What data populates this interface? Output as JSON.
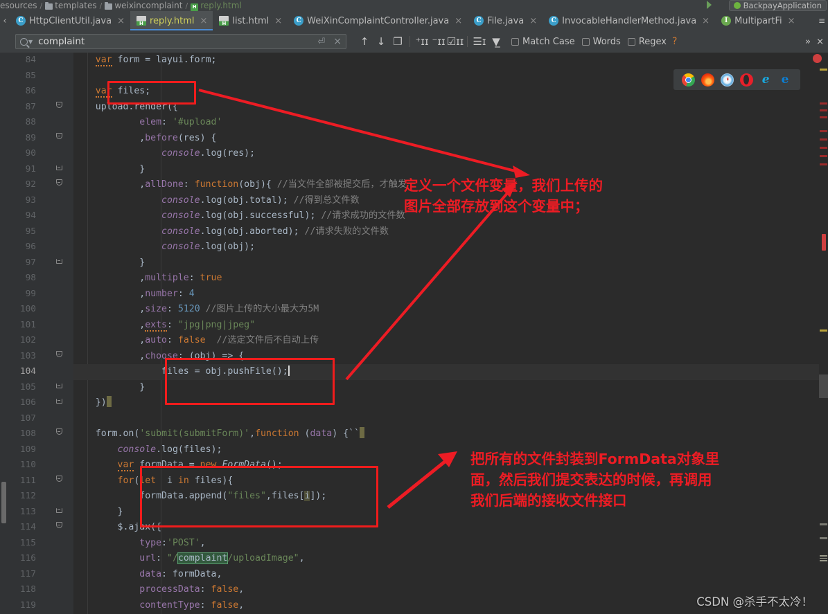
{
  "window": {
    "breadcrumb": [
      "esources",
      "templates",
      "weixincomplaint",
      "reply.html"
    ],
    "run_config": "BackpayApplication"
  },
  "tabs": [
    {
      "label": "HttpClientUtil.java",
      "icon": "java-class-icon",
      "active": false,
      "close": "×"
    },
    {
      "label": "reply.html",
      "icon": "html-file-icon",
      "active": true,
      "close": "×"
    },
    {
      "label": "list.html",
      "icon": "html-file-icon",
      "active": false,
      "close": "×"
    },
    {
      "label": "WeiXinComplaintController.java",
      "icon": "java-class-icon",
      "active": false,
      "close": "×"
    },
    {
      "label": "File.java",
      "icon": "java-class-icon",
      "active": false,
      "close": "×"
    },
    {
      "label": "InvocableHandlerMethod.java",
      "icon": "java-class-icon",
      "active": false,
      "close": "×"
    },
    {
      "label": "MultipartFi",
      "icon": "java-interface-icon",
      "active": false,
      "close": "×"
    }
  ],
  "find": {
    "value": "complaint",
    "search_icon": "search-icon",
    "dropdown_icon": "chevron-down-icon",
    "enter_icon": "enter-key-icon",
    "clear_icon": "close-icon",
    "prev_icon": "arrow-up-icon",
    "next_icon": "arrow-down-icon",
    "select_all_icon": "select-all-icon",
    "add_selection_icon": "add-selection-icon",
    "remove_selection_icon": "remove-selection-icon",
    "select_all_occurrences_icon": "select-all-occurrences-icon",
    "in_selection_icon": "in-selection-icon",
    "filter_icon": "filter-icon",
    "match_case": "Match Case",
    "words": "Words",
    "regex": "Regex",
    "help": "?",
    "more": "»",
    "close": "×"
  },
  "editor": {
    "first_line": 84,
    "current_line": 104,
    "lines": [
      {
        "n": 84,
        "fold": "",
        "indent": 0,
        "text": "    var form = layui.form;"
      },
      {
        "n": 85,
        "fold": "",
        "indent": 0,
        "text": ""
      },
      {
        "n": 86,
        "fold": "",
        "indent": 0,
        "text": "    var files;"
      },
      {
        "n": 87,
        "fold": "open",
        "indent": 0,
        "text": "    upload.render({"
      },
      {
        "n": 88,
        "fold": "",
        "indent": 0,
        "text": "            elem: '#upload'"
      },
      {
        "n": 89,
        "fold": "open",
        "indent": 0,
        "text": "            ,before(res) {"
      },
      {
        "n": 90,
        "fold": "",
        "indent": 0,
        "text": "                console.log(res);"
      },
      {
        "n": 91,
        "fold": "end",
        "indent": 0,
        "text": "            }"
      },
      {
        "n": 92,
        "fold": "open",
        "indent": 0,
        "text": "            ,allDone: function(obj){ //当文件全部被提交后，才触发"
      },
      {
        "n": 93,
        "fold": "",
        "indent": 0,
        "text": "                console.log(obj.total); //得到总文件数"
      },
      {
        "n": 94,
        "fold": "",
        "indent": 0,
        "text": "                console.log(obj.successful); //请求成功的文件数"
      },
      {
        "n": 95,
        "fold": "",
        "indent": 0,
        "text": "                console.log(obj.aborted); //请求失败的文件数"
      },
      {
        "n": 96,
        "fold": "",
        "indent": 0,
        "text": "                console.log(obj);"
      },
      {
        "n": 97,
        "fold": "end",
        "indent": 0,
        "text": "            }"
      },
      {
        "n": 98,
        "fold": "",
        "indent": 0,
        "text": "            ,multiple: true"
      },
      {
        "n": 99,
        "fold": "",
        "indent": 0,
        "text": "            ,number: 4"
      },
      {
        "n": 100,
        "fold": "",
        "indent": 0,
        "text": "            ,size: 5120 //图片上传的大小最大为5M"
      },
      {
        "n": 101,
        "fold": "",
        "indent": 0,
        "text": "            ,exts: \"jpg|png|jpeg\""
      },
      {
        "n": 102,
        "fold": "",
        "indent": 0,
        "text": "            ,auto: false  //选定文件后不自动上传"
      },
      {
        "n": 103,
        "fold": "open",
        "indent": 0,
        "text": "            ,choose: (obj) => {"
      },
      {
        "n": 104,
        "fold": "",
        "indent": 0,
        "text": "                files = obj.pushFile();"
      },
      {
        "n": 105,
        "fold": "end",
        "indent": 0,
        "text": "            }"
      },
      {
        "n": 106,
        "fold": "end",
        "indent": 0,
        "text": "    })"
      },
      {
        "n": 107,
        "fold": "",
        "indent": 0,
        "text": ""
      },
      {
        "n": 108,
        "fold": "open",
        "indent": 0,
        "text": "    form.on('submit(submitForm)',function (data) {``"
      },
      {
        "n": 109,
        "fold": "",
        "indent": 0,
        "text": "        console.log(files);"
      },
      {
        "n": 110,
        "fold": "",
        "indent": 0,
        "text": "        var formData = new FormData();"
      },
      {
        "n": 111,
        "fold": "open",
        "indent": 0,
        "text": "        for(let  i in files){"
      },
      {
        "n": 112,
        "fold": "",
        "indent": 0,
        "text": "            formData.append(\"files\",files[i]);"
      },
      {
        "n": 113,
        "fold": "end",
        "indent": 0,
        "text": "        }"
      },
      {
        "n": 114,
        "fold": "open",
        "indent": 0,
        "text": "        $.ajax({"
      },
      {
        "n": 115,
        "fold": "",
        "indent": 0,
        "text": "            type:'POST',"
      },
      {
        "n": 116,
        "fold": "",
        "indent": 0,
        "text": "            url: \"/complaint/uploadImage\","
      },
      {
        "n": 117,
        "fold": "",
        "indent": 0,
        "text": "            data: formData,"
      },
      {
        "n": 118,
        "fold": "",
        "indent": 0,
        "text": "            processData: false,"
      },
      {
        "n": 119,
        "fold": "",
        "indent": 0,
        "text": "            contentType: false,"
      }
    ]
  },
  "annotations": {
    "note1": "定义一个文件变量，我们上传的\n图片全部存放到这个变量中；",
    "note2": "把所有的文件封装到FormData对象里\n面，然后我们提交表达的时候，再调用\n我们后端的接收文件接口",
    "accent_color": "#ed1c24"
  },
  "browser_bar": {
    "icons": [
      "chrome-icon",
      "firefox-icon",
      "safari-icon",
      "opera-icon",
      "internet-explorer-icon",
      "edge-icon"
    ],
    "glyphs": [
      "",
      "",
      "",
      "",
      "e",
      "e"
    ]
  },
  "watermark": "CSDN @杀手不太冷！"
}
